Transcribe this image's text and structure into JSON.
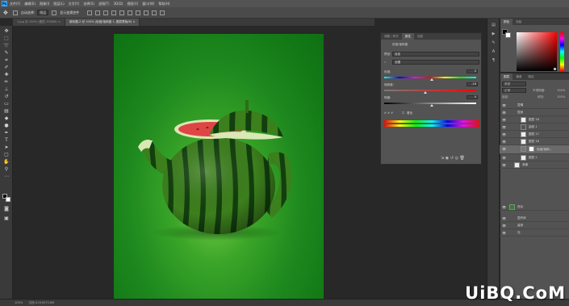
{
  "menubar": {
    "logo": "Ps",
    "items": [
      "文件(F)",
      "编辑(E)",
      "图像(I)",
      "图层(L)",
      "文字(Y)",
      "选择(S)",
      "滤镜(T)",
      "3D(D)",
      "视图(V)",
      "窗口(W)",
      "帮助(H)"
    ]
  },
  "options": {
    "auto_select_label": "自动选择:",
    "auto_select_value": "图层",
    "show_transform_label": "显示变换控件"
  },
  "document_tabs": [
    {
      "label": "1.jpg @ 100% (图层, RGB/8) ×"
    },
    {
      "label": "新标题-2 @ 100% (色相/饱和度 1, 图层蒙版/8) ×"
    }
  ],
  "properties": {
    "tabs": [
      "调整 / 样式",
      "属性",
      "信息"
    ],
    "adjustment_title": "色相/饱和度",
    "preset_label": "预设:",
    "preset_value": "自定",
    "channel_value": "全图",
    "hue_label": "色相:",
    "hue_value": "0",
    "saturation_label": "饱和度:",
    "saturation_value": "-16",
    "lightness_label": "明度:",
    "lightness_value": "0",
    "colorize_label": "着色"
  },
  "color_panel": {
    "tabs": [
      "颜色",
      "色板"
    ]
  },
  "layers_panel": {
    "tabs": [
      "图层",
      "通道",
      "路径"
    ],
    "kind_label": "类型",
    "blend_mode": "正常",
    "opacity_label": "不透明度:",
    "opacity_value": "100%",
    "lock_label": "锁定:",
    "fill_label": "填充:",
    "fill_value": "100%",
    "layers": [
      {
        "name": "壶嘴",
        "selected": false
      },
      {
        "name": "壶身",
        "selected": false
      },
      {
        "name": "图层 16",
        "selected": false
      },
      {
        "name": "曲线 1",
        "selected": false
      },
      {
        "name": "图层 17",
        "selected": false
      },
      {
        "name": "图层 18",
        "selected": false
      },
      {
        "name": "色相/饱和...",
        "selected": true
      },
      {
        "name": "图层 2",
        "selected": false
      },
      {
        "name": "背景",
        "selected": false
      },
      {
        "name": "西瓜",
        "selected": false
      },
      {
        "name": "壶杆体",
        "selected": false
      },
      {
        "name": "装饰",
        "selected": false
      },
      {
        "name": "光",
        "selected": false
      }
    ]
  },
  "statusbar": {
    "zoom": "100%",
    "doc_size": "文档:3.01M/73.6M"
  },
  "watermark": "UiBQ.CoM",
  "colors": {
    "canvas_green": "#1f8a1f",
    "ui_panel": "#535353",
    "ui_dark": "#282828"
  },
  "adjustments": {
    "hue_slider": 0.52,
    "saturation_slider": 0.45,
    "lightness_slider": 0.52
  }
}
